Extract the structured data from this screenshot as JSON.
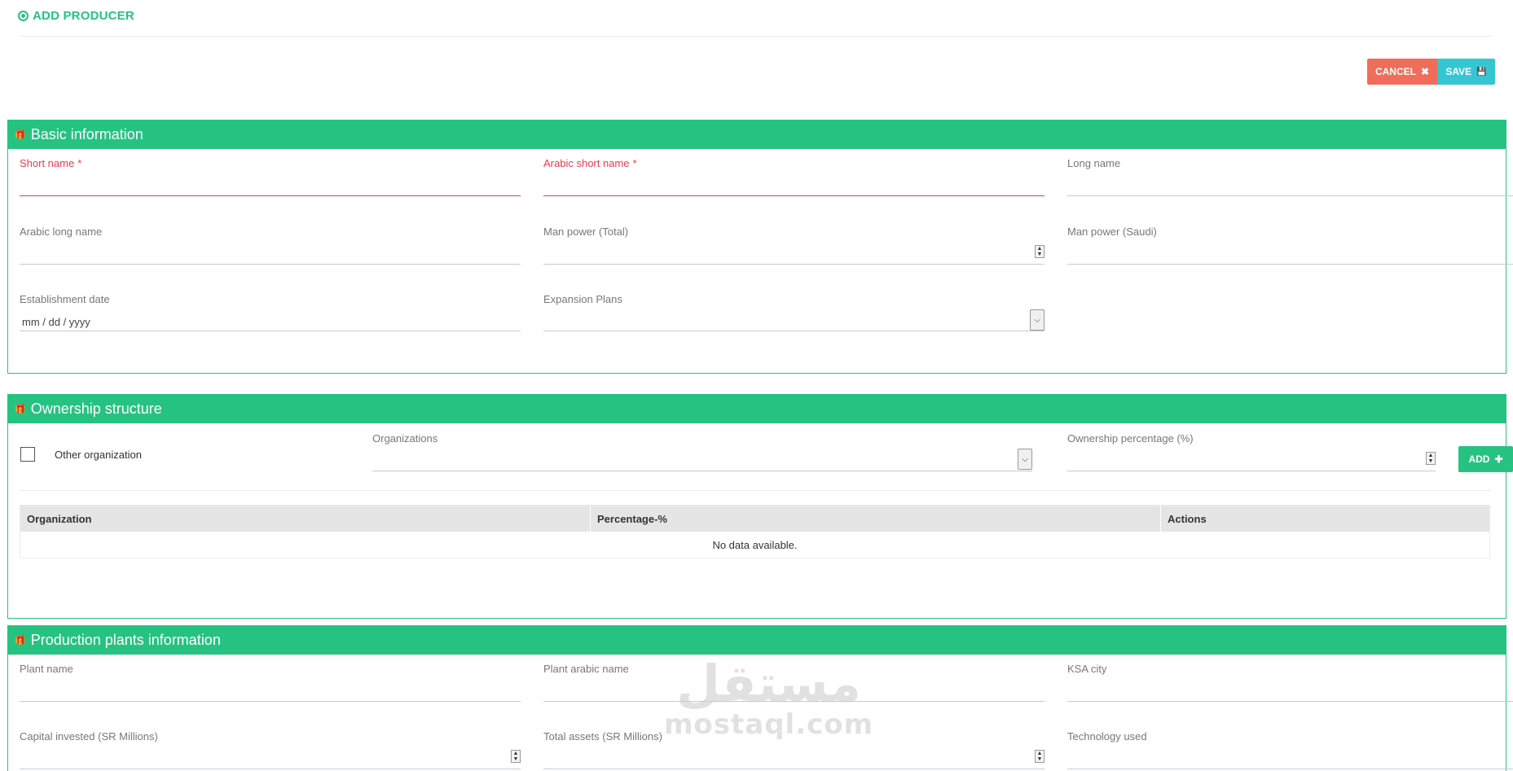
{
  "header": {
    "title": "ADD PRODUCER"
  },
  "actions": {
    "cancel_label": "CANCEL",
    "cancel_icon": "✖",
    "save_label": "SAVE",
    "save_icon": "💾"
  },
  "basic": {
    "title": "Basic information",
    "short_name": {
      "label": "Short name",
      "required": "*"
    },
    "arabic_short_name": {
      "label": "Arabic short name",
      "required": "*"
    },
    "long_name": {
      "label": "Long name"
    },
    "arabic_long_name": {
      "label": "Arabic long name"
    },
    "man_power_total": {
      "label": "Man power (Total)"
    },
    "man_power_saudi": {
      "label": "Man power (Saudi)"
    },
    "establishment_date": {
      "label": "Establishment date",
      "placeholder": "mm / dd / yyyy"
    },
    "expansion_plans": {
      "label": "Expansion Plans"
    }
  },
  "ownership": {
    "title": "Ownership structure",
    "other_org_label": "Other organization",
    "organizations_label": "Organizations",
    "percentage_label": "Ownership percentage (%)",
    "add_label": "ADD",
    "add_icon": "✚",
    "table": {
      "columns": [
        "Organization",
        "Percentage-%",
        "Actions"
      ],
      "empty_text": "No data available."
    }
  },
  "plants": {
    "title": "Production plants information",
    "plant_name": {
      "label": "Plant name"
    },
    "plant_arabic_name": {
      "label": "Plant arabic name"
    },
    "ksa_city": {
      "label": "KSA city"
    },
    "capital_invested": {
      "label": "Capital invested (SR Millions)"
    },
    "total_assets": {
      "label": "Total assets (SR Millions)"
    },
    "technology_used": {
      "label": "Technology used"
    }
  },
  "watermark": {
    "arabic": "مستقل",
    "latin": "mostaql.com"
  },
  "colors": {
    "accent": "#26c281",
    "cancel": "#ee6e5a",
    "save": "#36c6d3",
    "error": "#e73d4a"
  }
}
